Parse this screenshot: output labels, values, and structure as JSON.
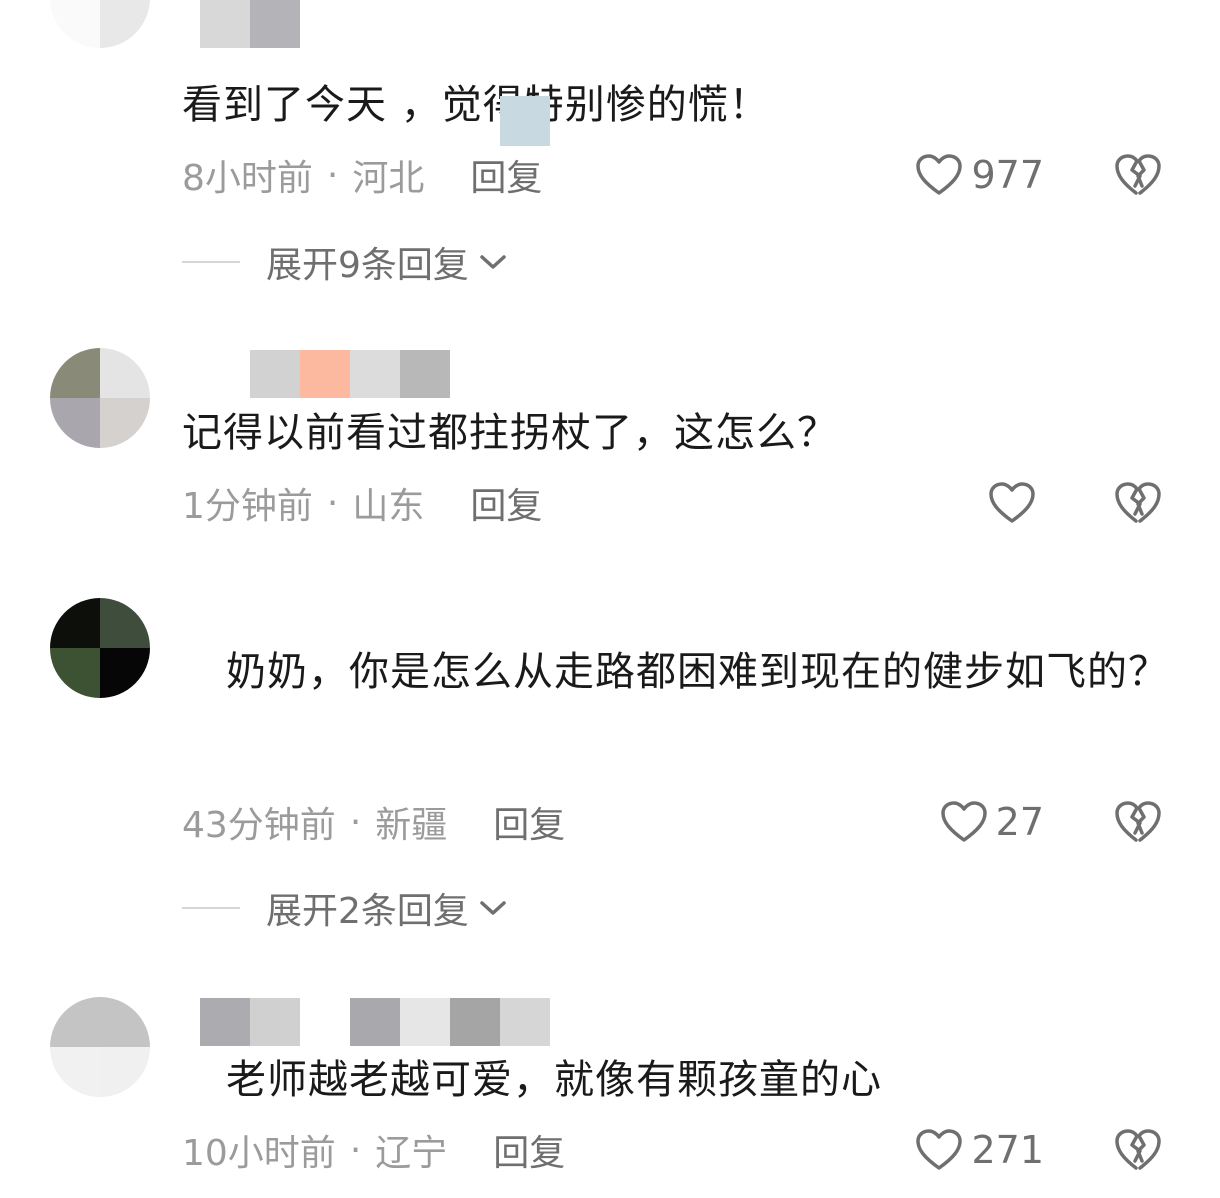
{
  "comments": [
    {
      "text": "看到了今天 ，觉得特别惨的慌！",
      "time": "8小时前",
      "region": "河北",
      "reply_label": "回复",
      "likes": "977",
      "expand_label": "展开9条回复"
    },
    {
      "text": "记得以前看过都拄拐杖了，这怎么？",
      "time": "1分钟前",
      "region": "山东",
      "reply_label": "回复",
      "likes": ""
    },
    {
      "text": "奶奶，你是怎么从走路都困难到现在的健步如飞的？",
      "time": "43分钟前",
      "region": "新疆",
      "reply_label": "回复",
      "likes": "27",
      "expand_label": "展开2条回复"
    },
    {
      "text": "老师越老越可爱，就像有颗孩童的心",
      "time": "10小时前",
      "region": "辽宁",
      "reply_label": "回复",
      "likes": "271"
    }
  ],
  "separator": "·",
  "icons": {
    "like": "heart-outline-icon",
    "dislike": "broken-heart-icon",
    "expand": "chevron-down-icon"
  },
  "colors": {
    "text": "#1a1a1a",
    "meta": "#9b9b9b",
    "action": "#6f6f6f"
  }
}
